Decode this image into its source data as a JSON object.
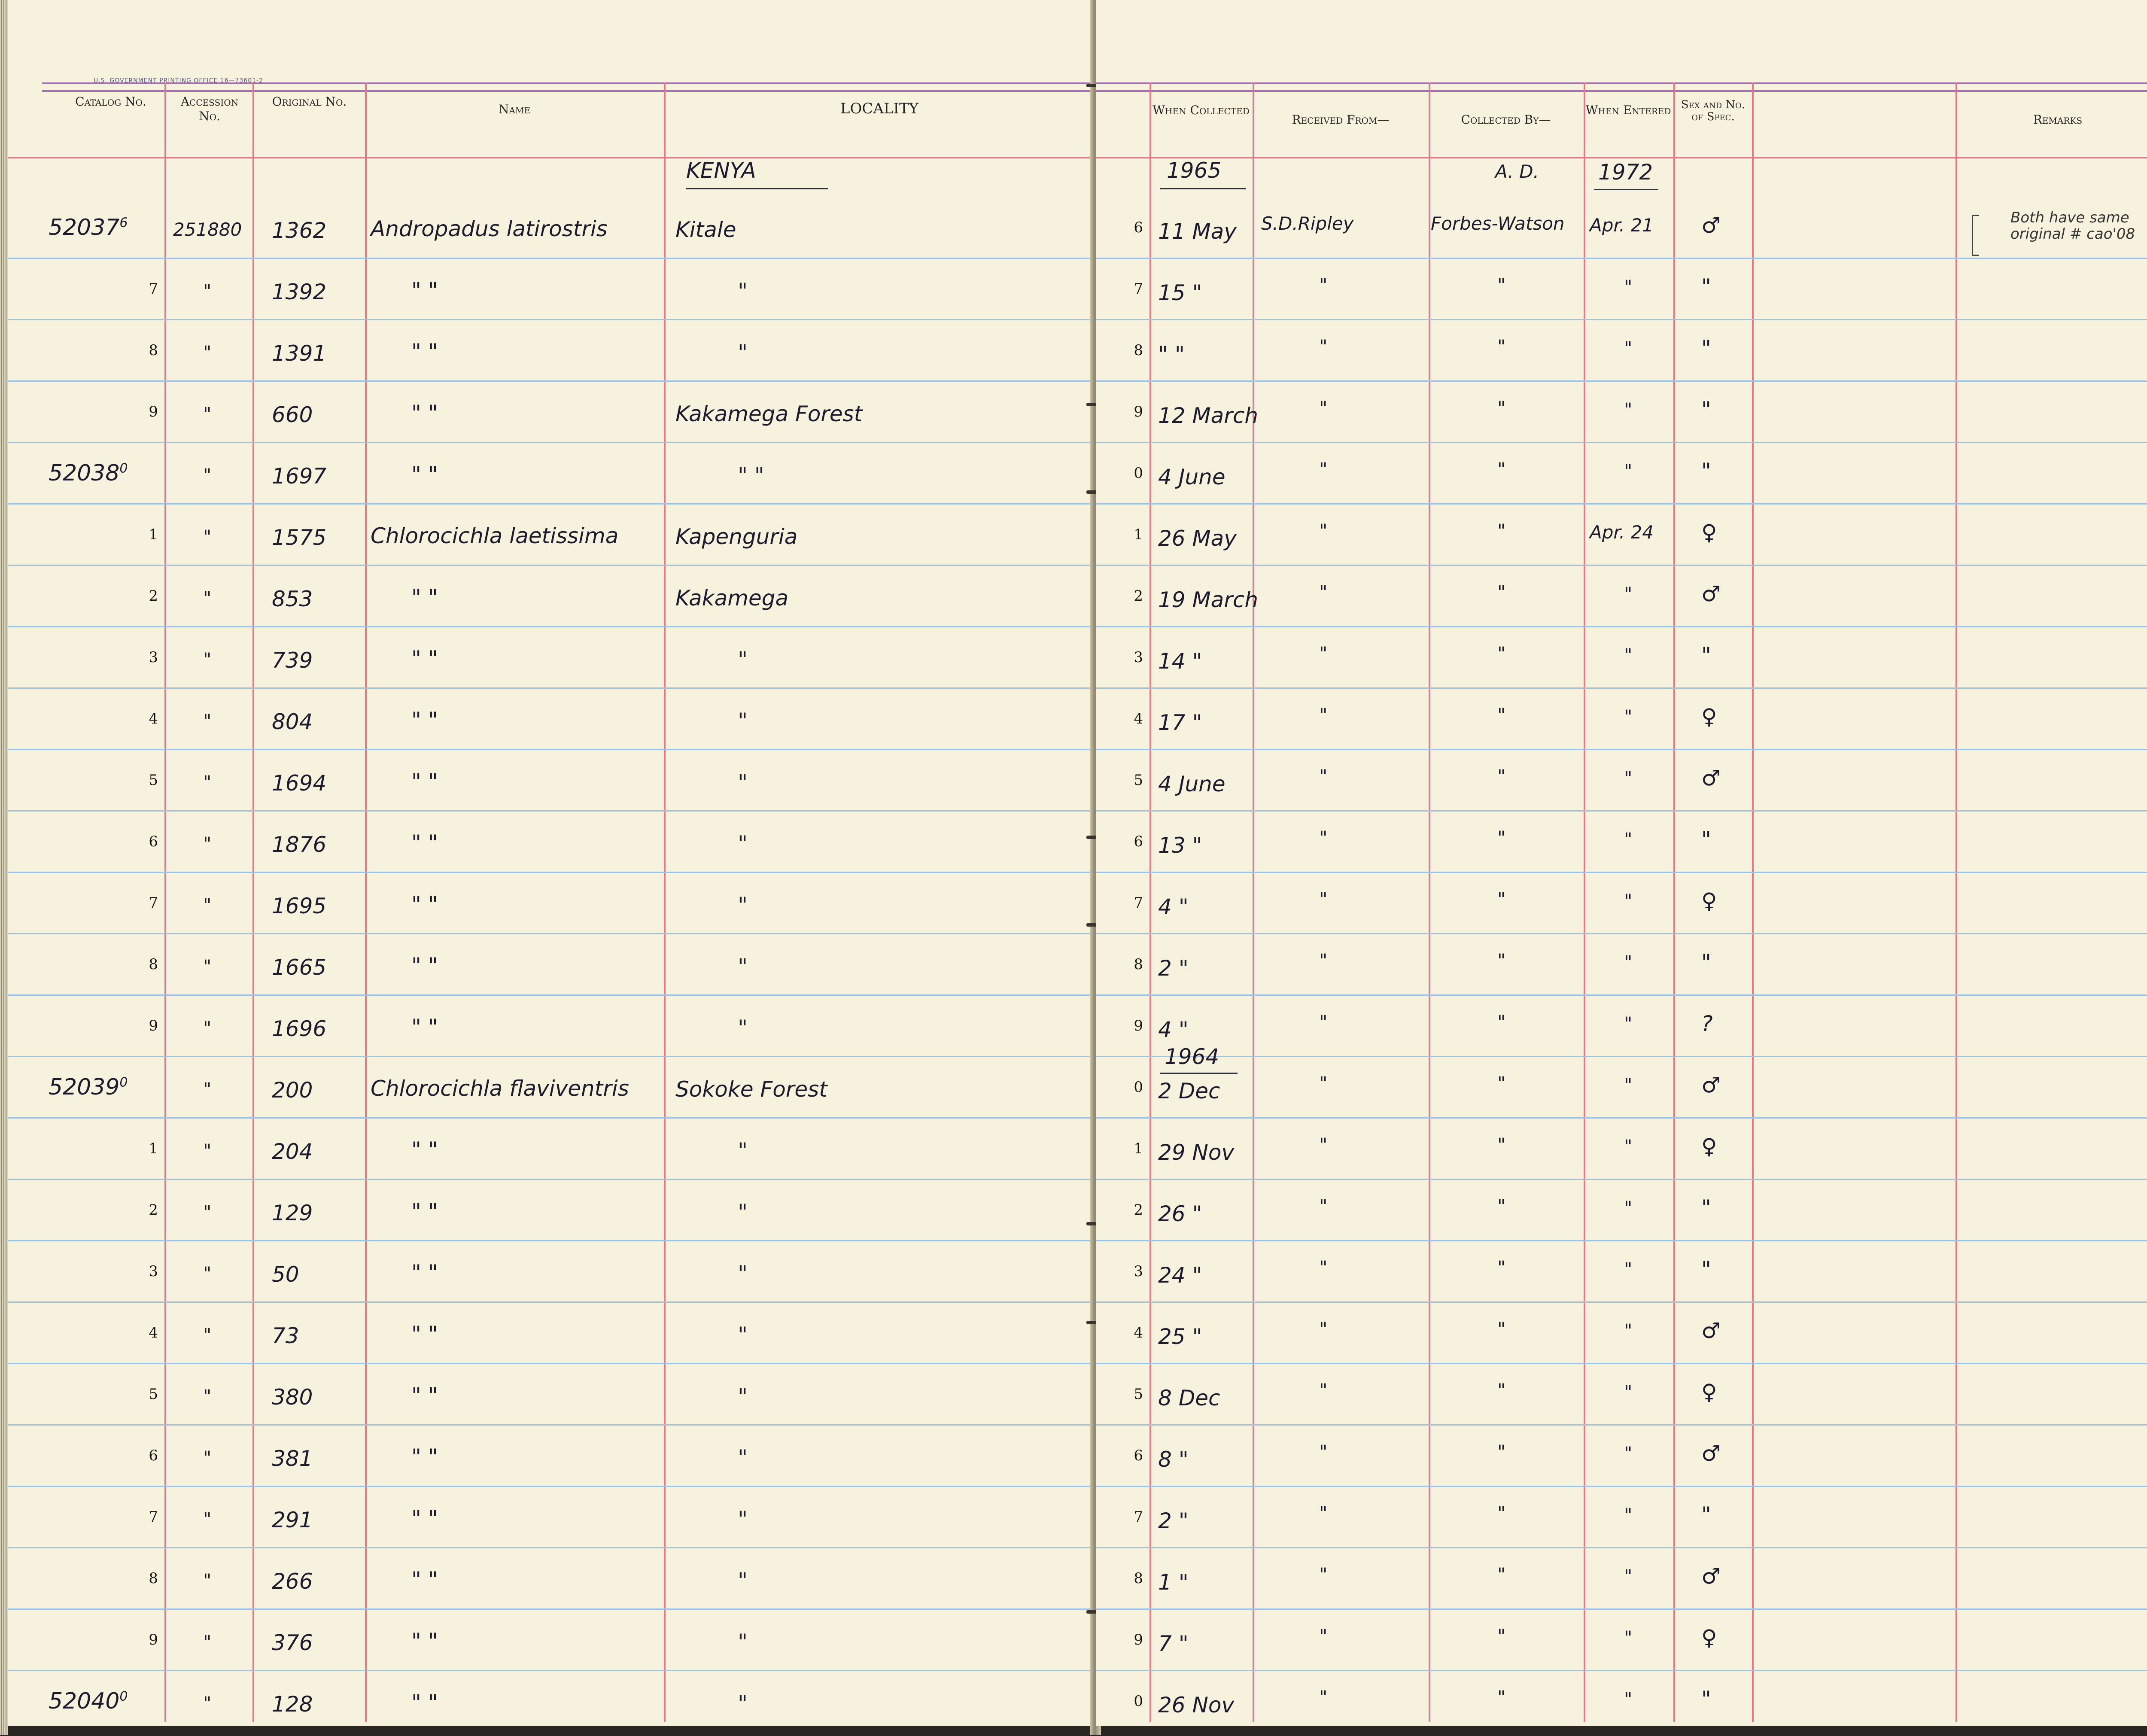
{
  "printer_line": "U.S. GOVERNMENT PRINTING OFFICE    16—73601-2",
  "left_headers": {
    "catalog": "Catalog No.",
    "accession": "Accession No.",
    "original": "Original No.",
    "name": "Name",
    "locality": "LOCALITY"
  },
  "right_headers": {
    "when_collected": "When Collected",
    "received_from": "Received From—",
    "collected_by": "Collected By—",
    "when_entered": "When Entered",
    "sex": "Sex and No. of Spec.",
    "remarks": "Remarks"
  },
  "header_row": {
    "locality": "KENYA",
    "collected_year": "1965",
    "collected_by": "A. D.",
    "entered_year": "1972"
  },
  "remark": "Both have same original # cao'08",
  "rows": [
    {
      "cat": "52037",
      "sup": "6",
      "digit": "6",
      "acc": "251880",
      "orig": "1362",
      "name": "Andropadus latirostris",
      "loc": "Kitale",
      "coll": "11 May",
      "recv": "S.D.Ripley",
      "by": "Forbes-Watson",
      "ent": "Apr. 21",
      "sex": "♂"
    },
    {
      "cat": "",
      "sup": "",
      "digit": "7",
      "acc": "\"",
      "orig": "1392",
      "name": "\"        \"",
      "loc": "\"",
      "coll": "15 \"",
      "recv": "\"",
      "by": "\"",
      "ent": "\"",
      "sex": "\""
    },
    {
      "cat": "",
      "sup": "",
      "digit": "8",
      "acc": "\"",
      "orig": "1391",
      "name": "\"        \"",
      "loc": "\"",
      "coll": "\"  \"",
      "recv": "\"",
      "by": "\"",
      "ent": "\"",
      "sex": "\""
    },
    {
      "cat": "",
      "sup": "",
      "digit": "9",
      "acc": "\"",
      "orig": "660",
      "name": "\"        \"",
      "loc": "Kakamega Forest",
      "coll": "12 March",
      "recv": "\"",
      "by": "\"",
      "ent": "\"",
      "sex": "\""
    },
    {
      "cat": "52038",
      "sup": "0",
      "digit": "0",
      "acc": "\"",
      "orig": "1697",
      "name": "\"        \"",
      "loc": "\"        \"",
      "coll": "4 June",
      "recv": "\"",
      "by": "\"",
      "ent": "\"",
      "sex": "\""
    },
    {
      "cat": "",
      "sup": "",
      "digit": "1",
      "acc": "\"",
      "orig": "1575",
      "name": "Chlorocichla laetissima",
      "loc": "Kapenguria",
      "coll": "26 May",
      "recv": "\"",
      "by": "\"",
      "ent": "Apr. 24",
      "sex": "♀"
    },
    {
      "cat": "",
      "sup": "",
      "digit": "2",
      "acc": "\"",
      "orig": "853",
      "name": "\"        \"",
      "loc": "Kakamega",
      "coll": "19 March",
      "recv": "\"",
      "by": "\"",
      "ent": "\"",
      "sex": "♂"
    },
    {
      "cat": "",
      "sup": "",
      "digit": "3",
      "acc": "\"",
      "orig": "739",
      "name": "\"        \"",
      "loc": "\"",
      "coll": "14 \"",
      "recv": "\"",
      "by": "\"",
      "ent": "\"",
      "sex": "\""
    },
    {
      "cat": "",
      "sup": "",
      "digit": "4",
      "acc": "\"",
      "orig": "804",
      "name": "\"        \"",
      "loc": "\"",
      "coll": "17 \"",
      "recv": "\"",
      "by": "\"",
      "ent": "\"",
      "sex": "♀"
    },
    {
      "cat": "",
      "sup": "",
      "digit": "5",
      "acc": "\"",
      "orig": "1694",
      "name": "\"        \"",
      "loc": "\"",
      "coll": "4 June",
      "recv": "\"",
      "by": "\"",
      "ent": "\"",
      "sex": "♂"
    },
    {
      "cat": "",
      "sup": "",
      "digit": "6",
      "acc": "\"",
      "orig": "1876",
      "name": "\"        \"",
      "loc": "\"",
      "coll": "13 \"",
      "recv": "\"",
      "by": "\"",
      "ent": "\"",
      "sex": "\""
    },
    {
      "cat": "",
      "sup": "",
      "digit": "7",
      "acc": "\"",
      "orig": "1695",
      "name": "\"        \"",
      "loc": "\"",
      "coll": "4 \"",
      "recv": "\"",
      "by": "\"",
      "ent": "\"",
      "sex": "♀"
    },
    {
      "cat": "",
      "sup": "",
      "digit": "8",
      "acc": "\"",
      "orig": "1665",
      "name": "\"        \"",
      "loc": "\"",
      "coll": "2 \"",
      "recv": "\"",
      "by": "\"",
      "ent": "\"",
      "sex": "\""
    },
    {
      "cat": "",
      "sup": "",
      "digit": "9",
      "acc": "\"",
      "orig": "1696",
      "name": "\"        \"",
      "loc": "\"",
      "coll": "4 \"",
      "recv": "\"",
      "by": "\"",
      "ent": "\"",
      "sex": "?"
    },
    {
      "cat": "52039",
      "sup": "0",
      "digit": "0",
      "acc": "\"",
      "orig": "200",
      "name": "Chlorocichla flaviventris",
      "loc": "Sokoke Forest",
      "coll": "2 Dec",
      "recv": "\"",
      "by": "\"",
      "ent": "\"",
      "sex": "♂",
      "year": "1964"
    },
    {
      "cat": "",
      "sup": "",
      "digit": "1",
      "acc": "\"",
      "orig": "204",
      "name": "\"        \"",
      "loc": "\"",
      "coll": "29 Nov",
      "recv": "\"",
      "by": "\"",
      "ent": "\"",
      "sex": "♀"
    },
    {
      "cat": "",
      "sup": "",
      "digit": "2",
      "acc": "\"",
      "orig": "129",
      "name": "\"        \"",
      "loc": "\"",
      "coll": "26 \"",
      "recv": "\"",
      "by": "\"",
      "ent": "\"",
      "sex": "\""
    },
    {
      "cat": "",
      "sup": "",
      "digit": "3",
      "acc": "\"",
      "orig": "50",
      "name": "\"        \"",
      "loc": "\"",
      "coll": "24 \"",
      "recv": "\"",
      "by": "\"",
      "ent": "\"",
      "sex": "\""
    },
    {
      "cat": "",
      "sup": "",
      "digit": "4",
      "acc": "\"",
      "orig": "73",
      "name": "\"        \"",
      "loc": "\"",
      "coll": "25 \"",
      "recv": "\"",
      "by": "\"",
      "ent": "\"",
      "sex": "♂"
    },
    {
      "cat": "",
      "sup": "",
      "digit": "5",
      "acc": "\"",
      "orig": "380",
      "name": "\"        \"",
      "loc": "\"",
      "coll": "8 Dec",
      "recv": "\"",
      "by": "\"",
      "ent": "\"",
      "sex": "♀"
    },
    {
      "cat": "",
      "sup": "",
      "digit": "6",
      "acc": "\"",
      "orig": "381",
      "name": "\"        \"",
      "loc": "\"",
      "coll": "8 \"",
      "recv": "\"",
      "by": "\"",
      "ent": "\"",
      "sex": "♂"
    },
    {
      "cat": "",
      "sup": "",
      "digit": "7",
      "acc": "\"",
      "orig": "291",
      "name": "\"        \"",
      "loc": "\"",
      "coll": "2 \"",
      "recv": "\"",
      "by": "\"",
      "ent": "\"",
      "sex": "\""
    },
    {
      "cat": "",
      "sup": "",
      "digit": "8",
      "acc": "\"",
      "orig": "266",
      "name": "\"        \"",
      "loc": "\"",
      "coll": "1 \"",
      "recv": "\"",
      "by": "\"",
      "ent": "\"",
      "sex": "♂"
    },
    {
      "cat": "",
      "sup": "",
      "digit": "9",
      "acc": "\"",
      "orig": "376",
      "name": "\"        \"",
      "loc": "\"",
      "coll": "7 \"",
      "recv": "\"",
      "by": "\"",
      "ent": "\"",
      "sex": "♀"
    },
    {
      "cat": "52040",
      "sup": "0",
      "digit": "0",
      "acc": "\"",
      "orig": "128",
      "name": "\"        \"",
      "loc": "\"",
      "coll": "26 Nov",
      "recv": "\"",
      "by": "\"",
      "ent": "\"",
      "sex": "\""
    }
  ]
}
